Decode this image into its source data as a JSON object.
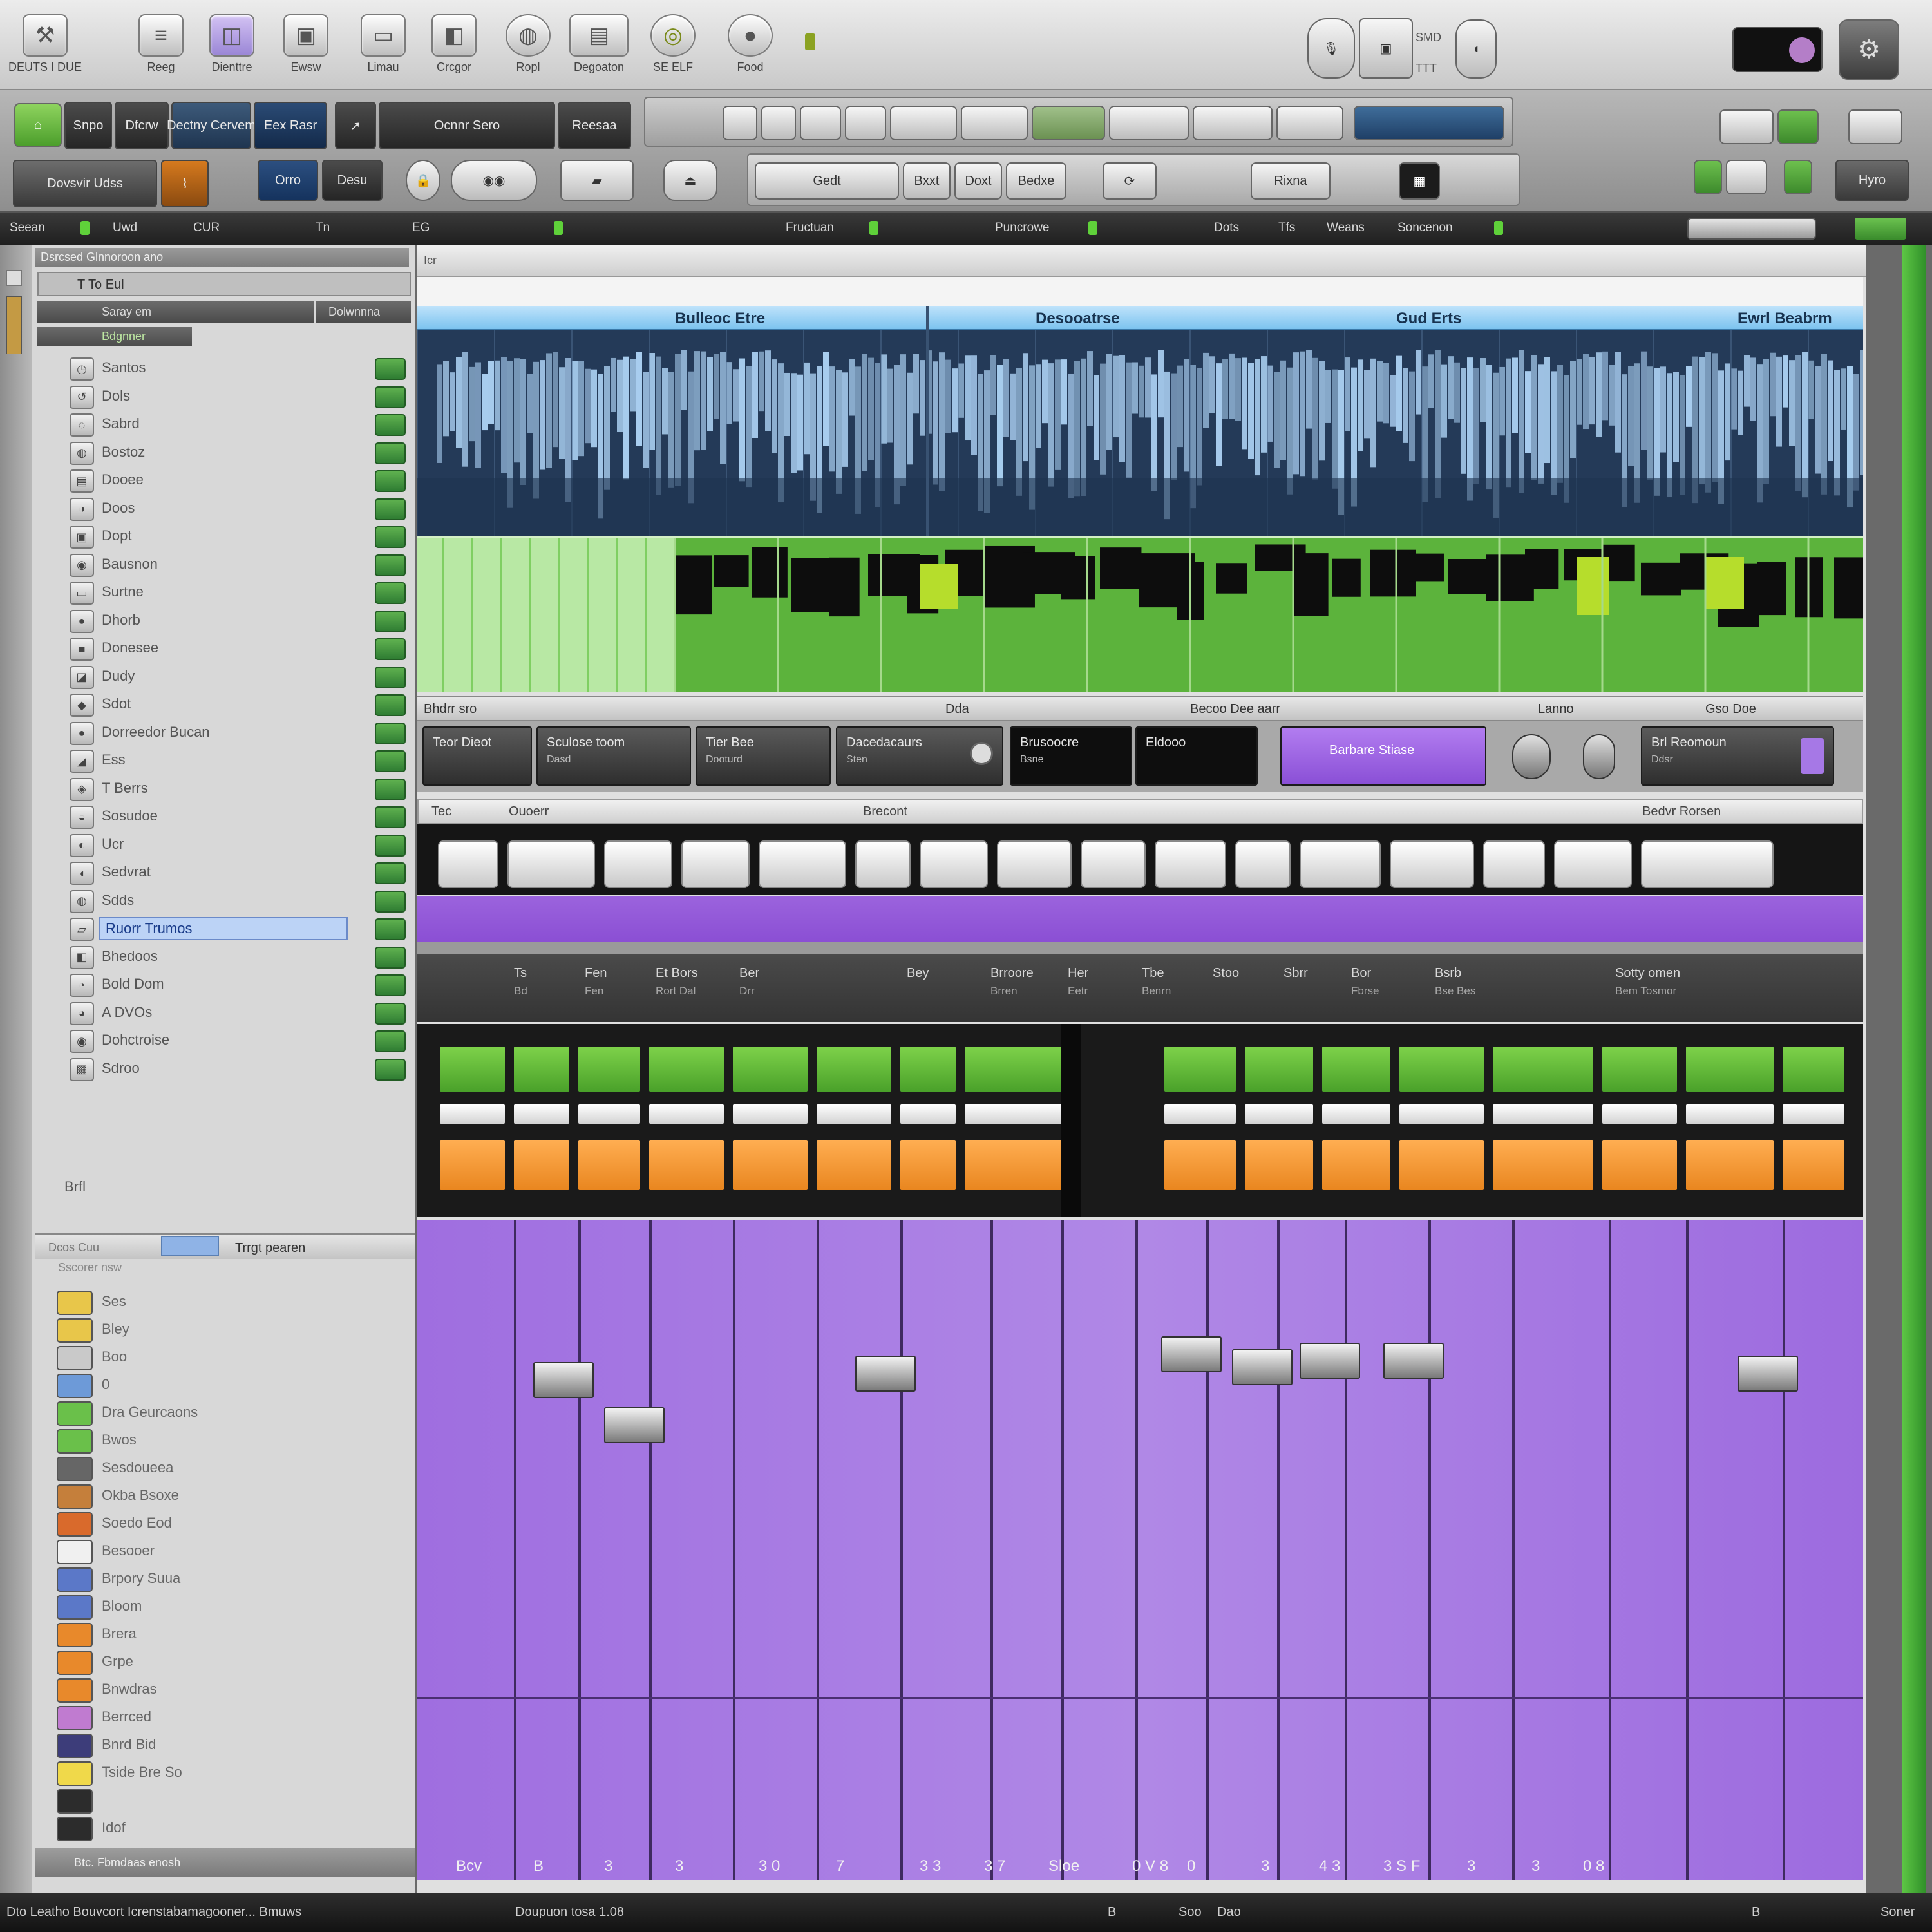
{
  "toolbar": {
    "tools": [
      {
        "label": "DEUTS I DUE",
        "icon": "tools-icon"
      },
      {
        "label": "Reeg",
        "icon": "list-icon"
      },
      {
        "label": "Dienttre",
        "icon": "cup-icon"
      },
      {
        "label": "Ewsw",
        "icon": "bin-icon"
      },
      {
        "label": "Limau",
        "icon": "monitor-icon"
      },
      {
        "label": "Crcgor",
        "icon": "devices-icon"
      },
      {
        "label": "Ropl",
        "icon": "dial-icon"
      },
      {
        "label": "Degoaton",
        "icon": "display-icon"
      },
      {
        "label": "SE ELF",
        "icon": "ring-icon"
      },
      {
        "label": "Food",
        "icon": "knob-icon"
      }
    ],
    "right_labels": [
      "SMD",
      "TTT"
    ]
  },
  "row2": {
    "pills": [
      "Snpo",
      "Dfcrw",
      "Dectny Cervem",
      "Eex Rasr",
      "Ocnnr Sero",
      "Reesaa",
      "Dovsvir Udss",
      "Orro",
      "Desu"
    ],
    "mid_buttons": [
      "Gedt",
      "Bxxt",
      "Doxt",
      "Bedxe",
      "Rixna"
    ],
    "right_button": "Hyro"
  },
  "transport": {
    "items": [
      "Seean",
      "Uwd",
      "CUR",
      "Tn",
      "EG",
      "Fructuan",
      "Puncrowe",
      "Dots",
      "Tfs",
      "Weans",
      "Soncenon"
    ]
  },
  "left_panel": {
    "header": "Dsrcsed Glnnoroon ano",
    "search": "T To Eul",
    "col_a": "Saray em",
    "col_b": "Dolwnnna",
    "group": "Bdgnner",
    "tracks": [
      "Santos",
      "Dols",
      "Sabrd",
      "Bostoz",
      "Dooee",
      "Doos",
      "Dopt",
      "Bausnon",
      "Surtne",
      "Dhorb",
      "Donesee",
      "Dudy",
      "Sdot",
      "Dorreedor Bucan",
      "Ess",
      "T Berrs",
      "Sosudoe",
      "Ucr",
      "Sedvrat",
      "Sdds",
      "Ruorr Trumos",
      "Bhedoos",
      "Bold Dom",
      "A DVOs",
      "Dohctroise",
      "Sdroo"
    ],
    "selected_index": 20,
    "footer": "Brfl",
    "lib_header": "Dcos  Cuu",
    "lib_tab": "Trrgt pearen",
    "lib_sub": "Sscorer nsw",
    "library": [
      {
        "name": "Ses",
        "color": "#e8c64a"
      },
      {
        "name": "Bley",
        "color": "#e8c64a"
      },
      {
        "name": "Boo",
        "color": "#c9c9c9"
      },
      {
        "name": "0",
        "color": "#6d9ad8"
      },
      {
        "name": "Dra Geurcaons",
        "color": "#6ac04a"
      },
      {
        "name": "Bwos",
        "color": "#6ac04a"
      },
      {
        "name": "Sesdoueea",
        "color": "#666666"
      },
      {
        "name": "Okba Bsoxe",
        "color": "#c57f3b"
      },
      {
        "name": "Soedo Eod",
        "color": "#d96a2c"
      },
      {
        "name": "Besooer",
        "color": "#f0f0f0"
      },
      {
        "name": "Brpory Suua",
        "color": "#5b78c8"
      },
      {
        "name": "Bloom",
        "color": "#5b78c8"
      },
      {
        "name": "Brera",
        "color": "#e8892b"
      },
      {
        "name": "Grpe",
        "color": "#e8892b"
      },
      {
        "name": "Bnwdras",
        "color": "#e8892b"
      },
      {
        "name": "Berrced",
        "color": "#c07bd0"
      },
      {
        "name": "Bnrd Bid",
        "color": "#3d3d7a"
      },
      {
        "name": "Tside Bre So",
        "color": "#f0d94a"
      },
      {
        "name": "",
        "color": "#2c2c2c"
      },
      {
        "name": "Idof",
        "color": "#2c2c2c"
      }
    ],
    "bottom": "Btc. Fbmdaas enosh"
  },
  "editor": {
    "ruler_label": "Icr",
    "regions": [
      "Bulleoc Etre",
      "Desooatrse",
      "Gud Erts",
      "Ewrl Beabrm"
    ],
    "edit_strip": [
      "Bhdrr sro",
      "Dda",
      "Becoo Dee aarr",
      "Lanno",
      "Gso Doe"
    ],
    "plugins": [
      {
        "name": "Teor Dieot",
        "sub": ""
      },
      {
        "name": "Sculose toom",
        "sub": "Dasd"
      },
      {
        "name": "Tier Bee",
        "sub": "Dooturd"
      },
      {
        "name": "Dacedacaurs",
        "sub": "Sten"
      },
      {
        "name": "Brusoocre",
        "sub": "Bsne"
      },
      {
        "name": "Eldooo",
        "sub": ""
      },
      {
        "name": "Barbare Stiase",
        "sub": ""
      },
      {
        "name": "Brl Reomoun",
        "sub": "Ddsr"
      }
    ],
    "preset_bar": [
      "Tec",
      "Ouoerr",
      "Brecont",
      "Bedvr Rorsen"
    ],
    "mixer_heads": [
      {
        "t": "",
        "s": ""
      },
      {
        "t": "Ts",
        "s": "Bd"
      },
      {
        "t": "Fen",
        "s": "Fen"
      },
      {
        "t": "Et Bors",
        "s": "Rort Dal"
      },
      {
        "t": "Ber",
        "s": "Drr"
      },
      {
        "t": "",
        "s": ""
      },
      {
        "t": "Bey",
        "s": ""
      },
      {
        "t": "Brroore",
        "s": "Brren"
      },
      {
        "t": "Her",
        "s": "Eetr"
      },
      {
        "t": "Tbe",
        "s": "Benrn"
      },
      {
        "t": "Stoo",
        "s": ""
      },
      {
        "t": "Sbrr",
        "s": ""
      },
      {
        "t": "Bor",
        "s": "Fbrse"
      },
      {
        "t": "Bsrb",
        "s": "Bse Bes"
      },
      {
        "t": "",
        "s": ""
      },
      {
        "t": "Sotty omen",
        "s": "Bem Tosmor"
      }
    ],
    "fader_foot": [
      "Bcv",
      "B",
      "3",
      "3",
      "3 0",
      "7",
      "3 3",
      "3 7",
      "Sloe",
      "0 V 8",
      "0",
      "3",
      "4 3",
      "3 S F",
      "3",
      "3",
      "0 8"
    ]
  },
  "statusbar": {
    "left": "Dto   Leatho  Bouvcort Icrenstabamagooner...  Bmuws",
    "mid": "Doupuon tosa 1.08",
    "right": [
      "B",
      "Soo",
      "Dao",
      "B",
      "Soner"
    ]
  },
  "colors": {
    "accent_green": "#6ac04a",
    "purple": "#9b63dd",
    "orange": "#f59a35",
    "blue_wave": "#9cc8ee"
  }
}
